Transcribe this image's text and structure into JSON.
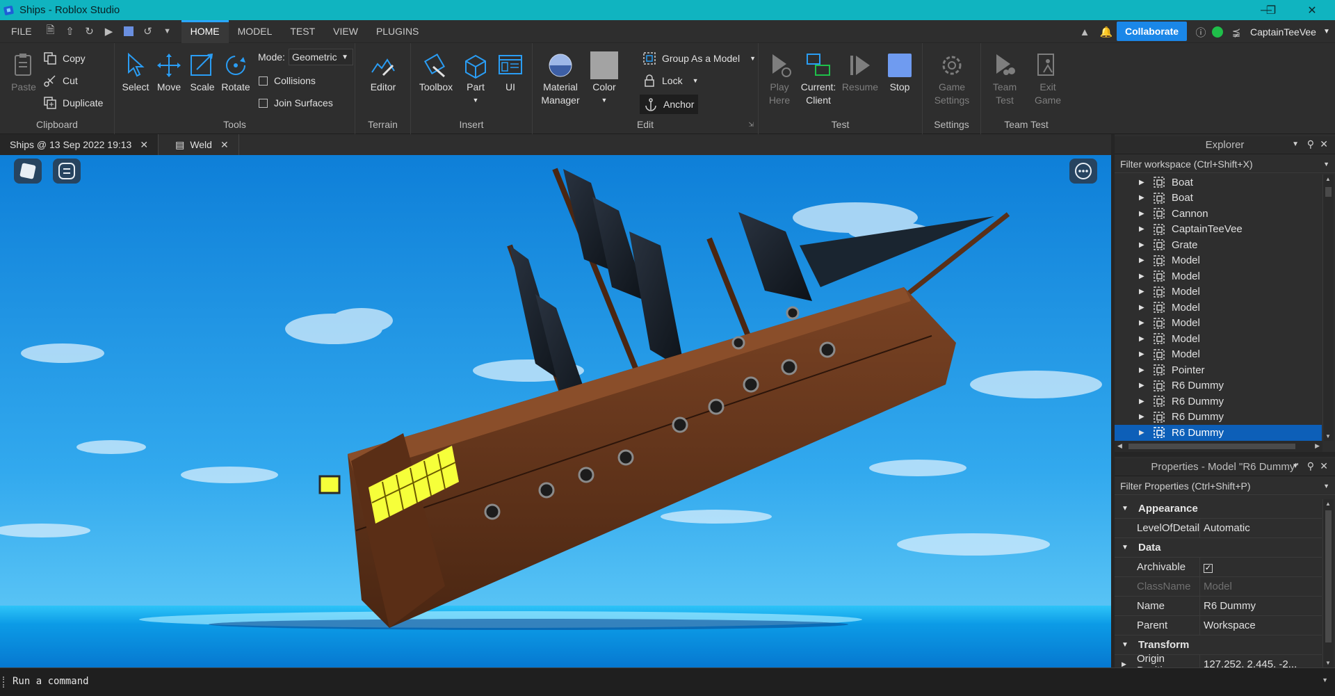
{
  "window": {
    "title": "Ships - Roblox Studio"
  },
  "menu": {
    "file": "FILE",
    "tabs": [
      "HOME",
      "MODEL",
      "TEST",
      "VIEW",
      "PLUGINS"
    ],
    "collaborate": "Collaborate",
    "user": "CaptainTeeVee"
  },
  "ribbon": {
    "clipboard": {
      "paste": "Paste",
      "copy": "Copy",
      "cut": "Cut",
      "duplicate": "Duplicate",
      "label": "Clipboard"
    },
    "tools": {
      "select": "Select",
      "move": "Move",
      "scale": "Scale",
      "rotate": "Rotate",
      "mode_label": "Mode:",
      "mode_value": "Geometric",
      "collisions": "Collisions",
      "join_surfaces": "Join Surfaces",
      "label": "Tools"
    },
    "terrain": {
      "editor": "Editor",
      "label": "Terrain"
    },
    "insert": {
      "toolbox": "Toolbox",
      "part": "Part",
      "ui": "UI",
      "label": "Insert"
    },
    "edit": {
      "material": "Material",
      "manager": "Manager",
      "color": "Color",
      "group": "Group As a Model",
      "lock": "Lock",
      "anchor": "Anchor",
      "label": "Edit"
    },
    "test": {
      "play": "Play",
      "here": "Here",
      "current": "Current:",
      "client": "Client",
      "resume": "Resume",
      "stop": "Stop",
      "label": "Test"
    },
    "settings": {
      "game": "Game",
      "settings": "Settings",
      "label": "Settings"
    },
    "teamtest": {
      "team": "Team",
      "test": "Test",
      "exit": "Exit",
      "game": "Game",
      "label": "Team Test"
    }
  },
  "doc_tabs": [
    {
      "label": "Ships @ 13 Sep 2022 19:13"
    },
    {
      "label": "Weld"
    }
  ],
  "explorer": {
    "title": "Explorer",
    "filter": "Filter workspace (Ctrl+Shift+X)",
    "items": [
      "Boat",
      "Boat",
      "Cannon",
      "CaptainTeeVee",
      "Grate",
      "Model",
      "Model",
      "Model",
      "Model",
      "Model",
      "Model",
      "Model",
      "Pointer",
      "R6 Dummy",
      "R6 Dummy",
      "R6 Dummy",
      "R6 Dummy"
    ],
    "selected_index": 16
  },
  "properties": {
    "title": "Properties - Model \"R6 Dummy\"",
    "filter": "Filter Properties (Ctrl+Shift+P)",
    "appearance": "Appearance",
    "level_of_detail": {
      "name": "LevelOfDetail",
      "value": "Automatic"
    },
    "data": "Data",
    "archivable": {
      "name": "Archivable",
      "checked": true
    },
    "classname": {
      "name": "ClassName",
      "value": "Model"
    },
    "name": {
      "name": "Name",
      "value": "R6 Dummy"
    },
    "parent": {
      "name": "Parent",
      "value": "Workspace"
    },
    "transform": "Transform",
    "origin_position": {
      "name": "Origin Position",
      "value": "127.252, 2.445, -2..."
    }
  },
  "command_bar": {
    "placeholder": "Run a command"
  },
  "colors": {
    "accent": "#1a87e8",
    "titlebar": "#10b4c0",
    "selection": "#0d5fb8",
    "sky": "#1e93e0",
    "sea": "#0aa3e6"
  }
}
